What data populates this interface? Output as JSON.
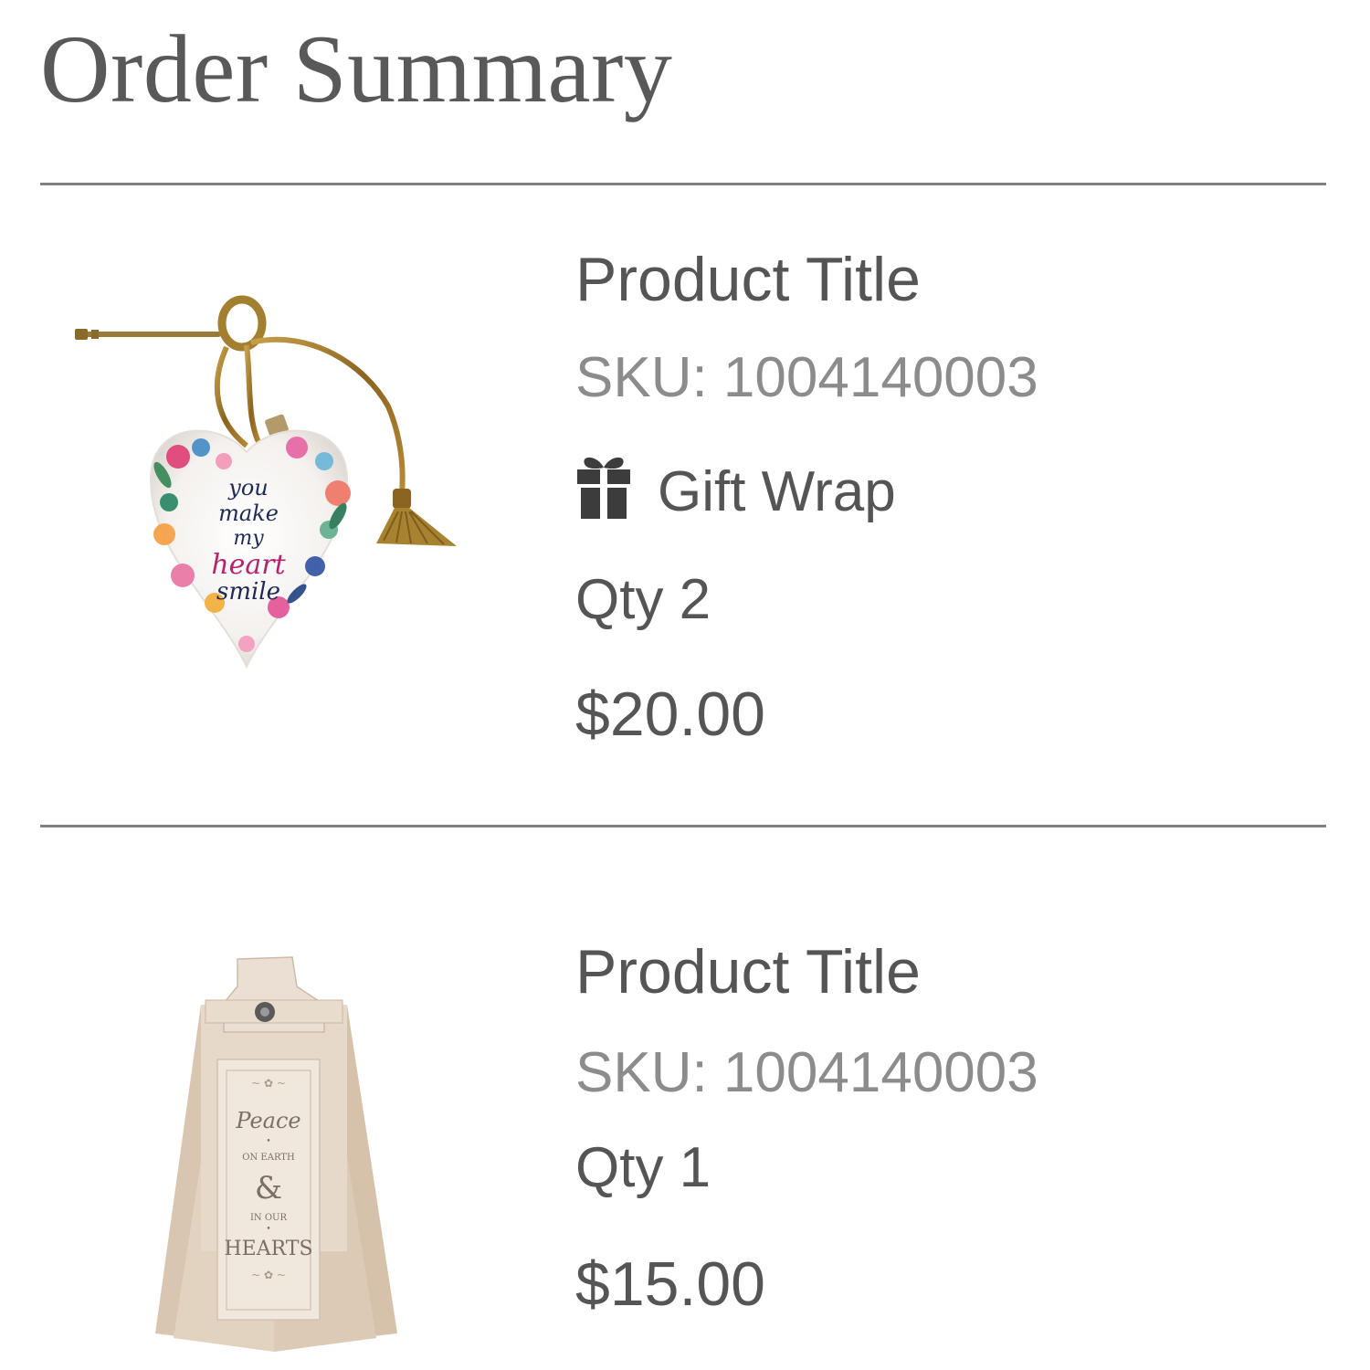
{
  "page": {
    "title": "Order Summary"
  },
  "items": [
    {
      "title": "Product Title",
      "sku": "SKU: 1004140003",
      "gift_wrap": "Gift Wrap",
      "gift_icon": "gift-icon",
      "qty": "Qty 2",
      "price": "$20.00",
      "image": "heart-ornament-image",
      "image_text": "you make my heart smile"
    },
    {
      "title": "Product Title",
      "sku": "SKU: 1004140003",
      "qty": "Qty 1",
      "price": "$15.00",
      "image": "tassel-ornament-image",
      "image_text": "Peace On Earth & In Our Hearts"
    }
  ],
  "colors": {
    "text": "#555555",
    "muted": "#8c8c8c",
    "divider": "#808080"
  }
}
